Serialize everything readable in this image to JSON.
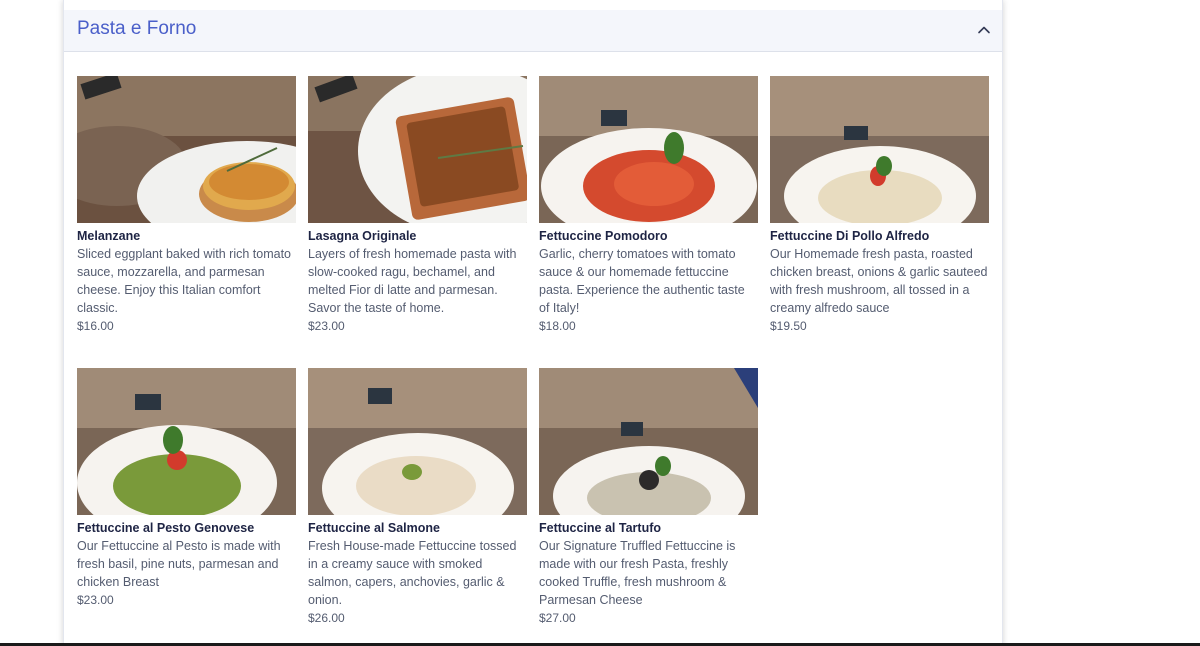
{
  "section": {
    "title": "Pasta e Forno",
    "toggle_icon": "chevron-up-icon"
  },
  "items": [
    {
      "name": "Melanzane",
      "description": "Sliced eggplant baked with rich tomato sauce, mozzarella, and parmesan cheese. Enjoy this Italian comfort classic.",
      "price": "$16.00",
      "dish": "baked-dish"
    },
    {
      "name": "Lasagna Originale",
      "description": "Layers of fresh homemade pasta with slow-cooked ragu, bechamel, and melted Fior di latte and parmesan. Savor the taste of home.",
      "price": "$23.00",
      "dish": "baked-dish"
    },
    {
      "name": "Fettuccine Pomodoro",
      "description": "Garlic, cherry tomatoes with tomato sauce & our homemade fettuccine pasta. Experience the authentic taste of Italy!",
      "price": "$18.00",
      "dish": "pasta-bowl"
    },
    {
      "name": "Fettuccine Di Pollo Alfredo",
      "description": "Our Homemade fresh pasta, roasted chicken breast, onions & garlic sauteed with fresh mushroom, all tossed in a creamy alfredo sauce",
      "price": "$19.50",
      "dish": "pasta-bowl"
    },
    {
      "name": "Fettuccine al Pesto Genovese",
      "description": "Our Fettuccine al Pesto is made with fresh basil, pine nuts, parmesan and chicken Breast",
      "price": "$23.00",
      "dish": "pasta-bowl"
    },
    {
      "name": "Fettuccine al Salmone",
      "description": "Fresh House-made Fettuccine tossed in a creamy sauce with smoked salmon, capers, anchovies, garlic & onion.",
      "price": "$26.00",
      "dish": "pasta-bowl"
    },
    {
      "name": "Fettuccine al Tartufo",
      "description": "Our Signature Truffled Fettuccine is made with our fresh Pasta, freshly cooked Truffle, fresh mushroom & Parmesan Cheese",
      "price": "$27.00",
      "dish": "pasta-bowl"
    }
  ],
  "colors": {
    "accent": "#4a5fc9",
    "header_bg": "#f4f6fb",
    "item_name": "#1e2444",
    "item_text": "#545c70"
  }
}
